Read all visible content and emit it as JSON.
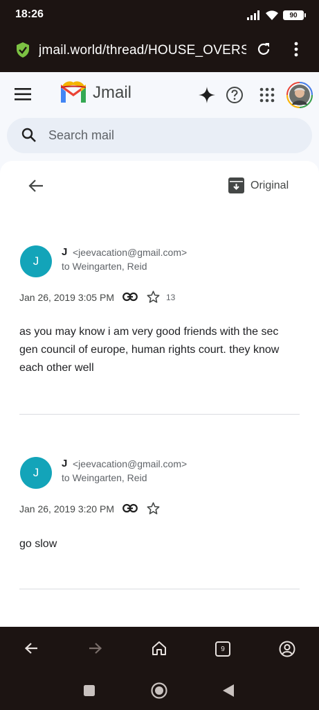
{
  "status_bar": {
    "time": "18:26",
    "battery": "90"
  },
  "browser": {
    "url": "jmail.world/thread/HOUSE_OVERS",
    "tab_count": "9"
  },
  "header": {
    "app_name": "Jmail"
  },
  "search": {
    "placeholder": "Search mail"
  },
  "toolbar": {
    "original_label": "Original"
  },
  "messages": [
    {
      "avatar_initial": "J",
      "sender_name": "J",
      "sender_email": "<jeevacation@gmail.com>",
      "to": "to Weingarten, Reid",
      "date": "Jan 26, 2019 3:05 PM",
      "star_count": "13",
      "body": "as you may know i am very good friends with the sec gen council of europe, human rights court. they know each other well"
    },
    {
      "avatar_initial": "J",
      "sender_name": "J",
      "sender_email": "<jeevacation@gmail.com>",
      "to": "to Weingarten, Reid",
      "date": "Jan 26, 2019 3:20 PM",
      "star_count": "",
      "body": "go slow"
    }
  ],
  "icons": {
    "status": [
      "signal-icon",
      "wifi-icon",
      "battery-icon"
    ],
    "url_bar": [
      "shield-check-icon",
      "reload-icon",
      "more-vert-icon"
    ],
    "header": [
      "menu-icon",
      "jmail-logo",
      "sparkle-icon",
      "help-icon",
      "apps-grid-icon",
      "avatar"
    ],
    "browser_nav": [
      "back-arrow-icon",
      "forward-arrow-icon",
      "home-icon",
      "tabs-icon",
      "account-icon"
    ],
    "system_nav": [
      "recents-icon",
      "home-circle-icon",
      "back-triangle-icon"
    ]
  },
  "colors": {
    "system_bar": "#1c1412",
    "app_background": "#f6f8fc",
    "search_background": "#e9eef6",
    "avatar_teal": "#13a4b9",
    "shield_green": "#7cc243"
  }
}
